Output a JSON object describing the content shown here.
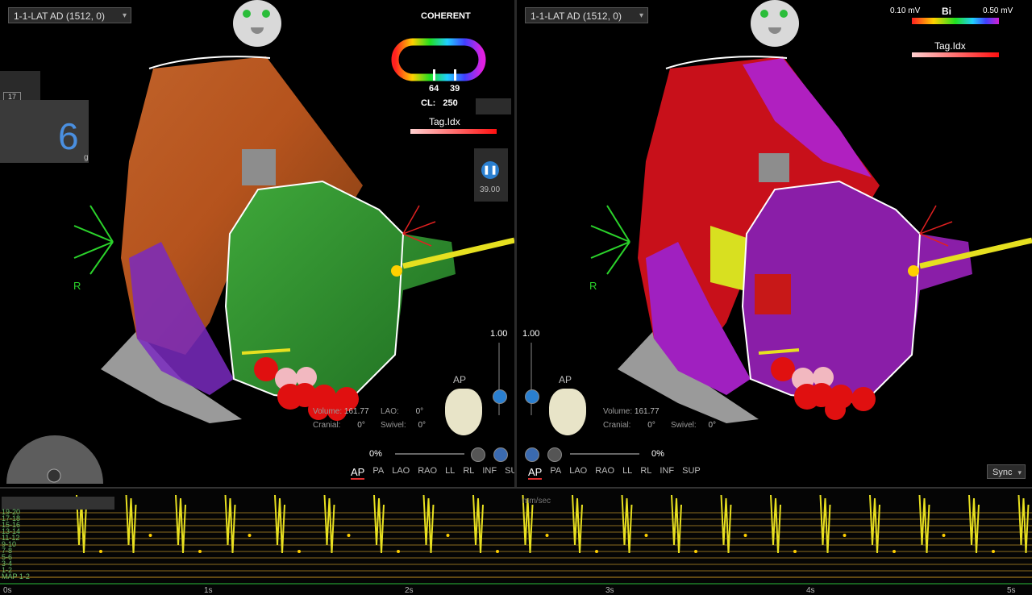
{
  "left": {
    "map_select": "1-1-LAT AD (1512, 0)",
    "coherent_label": "COHERENT",
    "cl_label": "CL:",
    "cl_value": "250",
    "ring_values": [
      "64",
      "39"
    ],
    "tag_label": "Tag.Idx",
    "pause_value": "39.00",
    "counter_value": "6",
    "counter_unit": "g",
    "counter_box": "17",
    "axis_label": "R",
    "zoom_value": "1.00",
    "view_label": "AP",
    "volume_label": "Volume:",
    "volume_value": "161.77",
    "cranial_label": "Cranial:",
    "cranial_value": "0",
    "lao_label": "LAO:",
    "lao_value": "0",
    "swivel_label": "Swivel:",
    "swivel_value": "0",
    "deg": "°",
    "opacity_value": "0%",
    "views": [
      "AP",
      "PA",
      "LAO",
      "RAO",
      "LL",
      "RL",
      "INF",
      "SUP"
    ]
  },
  "right": {
    "map_select": "1-1-LAT AD (1512, 0)",
    "scale_min": "0.10 mV",
    "scale_label": "Bi",
    "scale_max": "0.50 mV",
    "tag_label": "Tag.Idx",
    "axis_label": "R",
    "zoom_value": "1.00",
    "view_label": "AP",
    "volume_label": "Volume:",
    "volume_value": "161.77",
    "cranial_label": "Cranial:",
    "cranial_value": "0",
    "swivel_label": "Swivel:",
    "swivel_value": "0",
    "deg": "°",
    "opacity_value": "0%",
    "views": [
      "AP",
      "PA",
      "LAO",
      "RAO",
      "LL",
      "RL",
      "INF",
      "SUP"
    ],
    "sync_label": "Sync"
  },
  "ecg": {
    "channel_labels": [
      "19-20",
      "17-18",
      "15-16",
      "13-14",
      "11-12",
      "9-10",
      "7-8",
      "5-6",
      "3-4",
      "1-2",
      "MAP 1-2"
    ],
    "time_ticks": [
      "0s",
      "1s",
      "2s",
      "3s",
      "4s",
      "5s"
    ],
    "speed_label": "mm/sec"
  },
  "colors": {
    "accent_green": "#2bbd3a",
    "ecg_yellow": "#e8e020",
    "active_red": "#e03030"
  }
}
